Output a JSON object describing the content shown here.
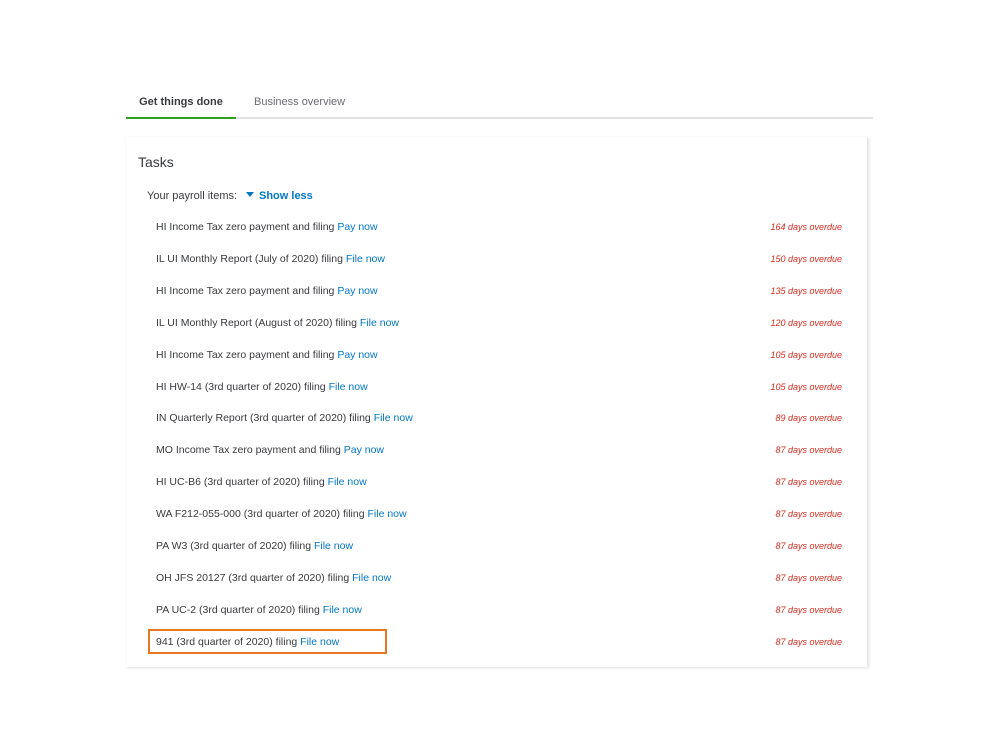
{
  "tabs": [
    {
      "label": "Get things done"
    },
    {
      "label": "Business overview"
    }
  ],
  "card": {
    "title": "Tasks",
    "payroll_label": "Your payroll items:",
    "toggle_label": "Show less"
  },
  "tasks": [
    {
      "desc": "HI Income Tax zero payment and filing ",
      "link": "Pay now",
      "status": "164 days overdue"
    },
    {
      "desc": "IL UI Monthly Report (July of 2020) filing ",
      "link": "File now",
      "status": "150 days overdue"
    },
    {
      "desc": "HI Income Tax zero payment and filing ",
      "link": "Pay now",
      "status": "135 days overdue"
    },
    {
      "desc": "IL UI Monthly Report (August of 2020) filing ",
      "link": "File now",
      "status": "120 days overdue"
    },
    {
      "desc": "HI Income Tax zero payment and filing ",
      "link": "Pay now",
      "status": "105 days overdue"
    },
    {
      "desc": "HI HW-14 (3rd quarter of 2020) filing ",
      "link": "File now",
      "status": "105 days overdue"
    },
    {
      "desc": "IN Quarterly Report (3rd quarter of 2020) filing ",
      "link": "File now",
      "status": "89 days overdue"
    },
    {
      "desc": "MO Income Tax zero payment and filing ",
      "link": "Pay now",
      "status": "87 days overdue"
    },
    {
      "desc": "HI UC-B6 (3rd quarter of 2020) filing ",
      "link": "File now",
      "status": "87 days overdue"
    },
    {
      "desc": "WA F212-055-000 (3rd quarter of 2020) filing ",
      "link": "File now",
      "status": "87 days overdue"
    },
    {
      "desc": "PA W3 (3rd quarter of 2020) filing ",
      "link": "File now",
      "status": "87 days overdue"
    },
    {
      "desc": "OH JFS 20127 (3rd quarter of 2020) filing ",
      "link": "File now",
      "status": "87 days overdue"
    },
    {
      "desc": "PA UC-2 (3rd quarter of 2020) filing ",
      "link": "File now",
      "status": "87 days overdue"
    },
    {
      "desc": "941 (3rd quarter of 2020) filing ",
      "link": "File now",
      "status": "87 days overdue"
    }
  ],
  "colors": {
    "active_tab_underline": "#2ca01c",
    "link": "#0077c5",
    "overdue": "#d52b1e",
    "highlight": "#e87722"
  }
}
